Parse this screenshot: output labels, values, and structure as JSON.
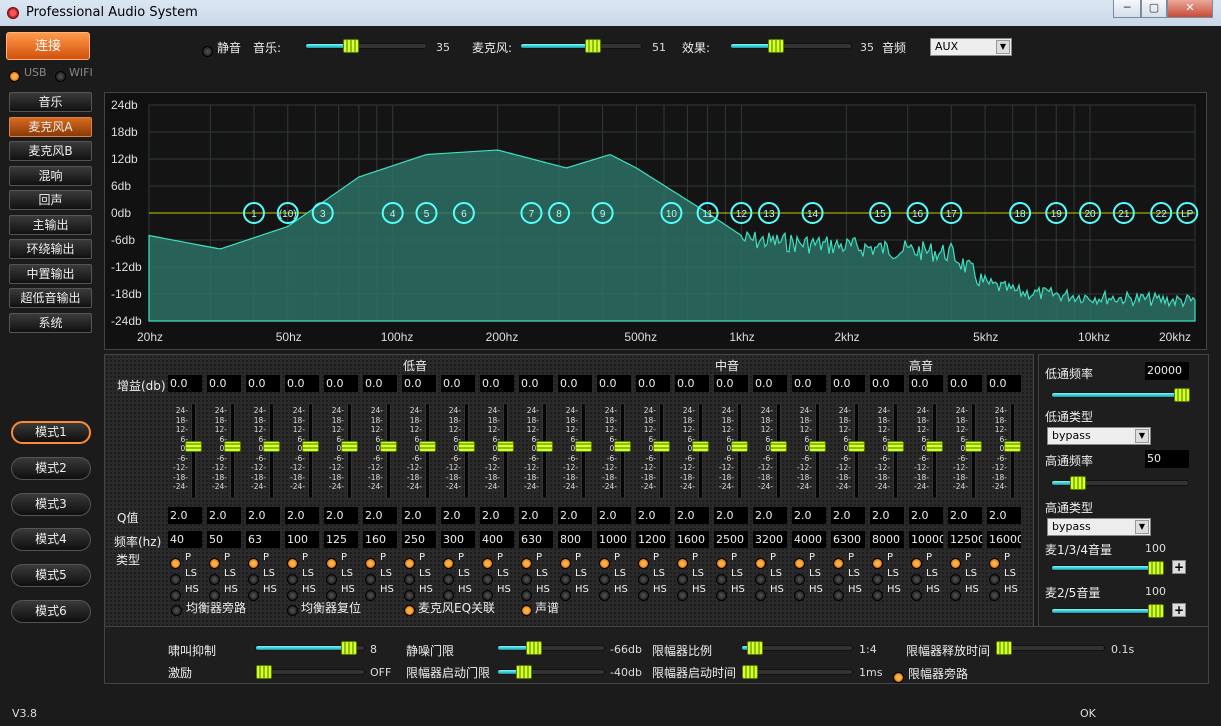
{
  "window": {
    "title": "Professional Audio System"
  },
  "connect": {
    "label": "连接",
    "usb": "USB",
    "wifi": "WIFI"
  },
  "topbar": {
    "mute": "静音",
    "music": {
      "label": "音乐:",
      "value": "35",
      "level": 0.35
    },
    "mic": {
      "label": "麦克风:",
      "value": "51",
      "level": 0.6
    },
    "effect": {
      "label": "效果:",
      "value": "35",
      "level": 0.35
    },
    "source": {
      "label": "音频",
      "value": "AUX"
    }
  },
  "sidebar": {
    "items": [
      "音乐",
      "麦克风A",
      "麦克风B",
      "混响",
      "回声",
      "主输出",
      "环绕输出",
      "中置输出",
      "超低音输出",
      "系统"
    ],
    "active": 1
  },
  "modes": {
    "items": [
      "模式1",
      "模式2",
      "模式3",
      "模式4",
      "模式5",
      "模式6"
    ],
    "active": 0
  },
  "chart_data": {
    "type": "area",
    "y_ticks": [
      "24db",
      "18db",
      "12db",
      "6db",
      "0db",
      "-6db",
      "-12db",
      "-18db",
      "-24db"
    ],
    "ylim": [
      -24,
      24
    ],
    "x_ticks": [
      "20hz",
      "50hz",
      "100hz",
      "200hz",
      "500hz",
      "1khz",
      "2khz",
      "5khz",
      "10khz",
      "20khz"
    ],
    "x_scale": "log",
    "xlim": [
      20,
      20000
    ],
    "x": [
      20,
      32,
      50,
      80,
      125,
      200,
      315,
      420,
      500,
      800,
      1000,
      1600,
      2500,
      4000,
      5000,
      6300,
      10000,
      20000
    ],
    "y": [
      -5,
      -8,
      -3,
      8,
      13,
      14,
      10,
      13,
      10,
      0,
      -5,
      -6,
      -7,
      -8,
      -15,
      -17,
      -18,
      -19
    ],
    "markers": [
      "1",
      "(10)",
      "3",
      "4",
      "5",
      "6",
      "7",
      "8",
      "9",
      "10",
      "11",
      "12",
      "13",
      "14",
      "15",
      "16",
      "17",
      "18",
      "19",
      "20",
      "21",
      "22",
      "LP"
    ],
    "marker_freqs": [
      40,
      50,
      63,
      100,
      125,
      160,
      250,
      300,
      400,
      630,
      800,
      1000,
      1200,
      1600,
      2500,
      3200,
      4000,
      6300,
      8000,
      10000,
      12500,
      16000,
      19000
    ]
  },
  "eq": {
    "section_low": "低音",
    "section_mid": "中音",
    "section_high": "高音",
    "gain_label": "增益(db)",
    "q_label": "Q值",
    "freq_label": "频率(hz)",
    "type_label": "类型",
    "gains": [
      "0.0",
      "0.0",
      "0.0",
      "0.0",
      "0.0",
      "0.0",
      "0.0",
      "0.0",
      "0.0",
      "0.0",
      "0.0",
      "0.0",
      "0.0",
      "0.0",
      "0.0",
      "0.0",
      "0.0",
      "0.0",
      "0.0",
      "0.0",
      "0.0",
      "0.0"
    ],
    "q": [
      "2.0",
      "2.0",
      "2.0",
      "2.0",
      "2.0",
      "2.0",
      "2.0",
      "2.0",
      "2.0",
      "2.0",
      "2.0",
      "2.0",
      "2.0",
      "2.0",
      "2.0",
      "2.0",
      "2.0",
      "2.0",
      "2.0",
      "2.0",
      "2.0",
      "2.0"
    ],
    "freqs": [
      "40",
      "50",
      "63",
      "100",
      "125",
      "160",
      "250",
      "300",
      "400",
      "630",
      "800",
      "1000",
      "1200",
      "1600",
      "2500",
      "3200",
      "4000",
      "6300",
      "8000",
      "10000",
      "12500",
      "16000"
    ],
    "ticks": [
      "24-",
      "18-",
      "12-",
      "6-",
      "0-",
      "-6-",
      "-12-",
      "-18-",
      "-24-"
    ],
    "type_p": "P",
    "type_ls": "LS",
    "type_hs": "HS",
    "bypass": "均衡器旁路",
    "reset": "均衡器复位",
    "link": "麦克风EQ关联",
    "spectrum": "声谱"
  },
  "right": {
    "lp_freq_label": "低通频率",
    "lp_freq": "20000",
    "lp_level": 1.0,
    "lp_type_label": "低通类型",
    "lp_type": "bypass",
    "hp_freq_label": "高通频率",
    "hp_freq": "50",
    "hp_level": 0.15,
    "hp_type_label": "高通类型",
    "hp_type": "bypass",
    "vol_a_label": "麦1/3/4音量",
    "vol_a": "100",
    "vol_b_label": "麦2/5音量",
    "vol_b": "100",
    "plus": "+"
  },
  "bottom": {
    "howl": {
      "label": "啸叫抑制",
      "value": "8",
      "level": 0.9
    },
    "excite": {
      "label": "激励",
      "value": "OFF",
      "level": 0.0
    },
    "gate": {
      "label": "静噪门限",
      "value": "-66db",
      "level": 0.3
    },
    "lim_start": {
      "label": "限幅器启动门限",
      "value": "-40db",
      "level": 0.2
    },
    "ratio": {
      "label": "限幅器比例",
      "value": "1:4",
      "level": 0.05
    },
    "attack": {
      "label": "限幅器启动时间",
      "value": "1ms",
      "level": 0.0
    },
    "release": {
      "label": "限幅器释放时间",
      "value": "0.1s",
      "level": 0.0
    },
    "lim_bypass": "限幅器旁路"
  },
  "status": {
    "version": "V3.8",
    "ok": "OK"
  }
}
